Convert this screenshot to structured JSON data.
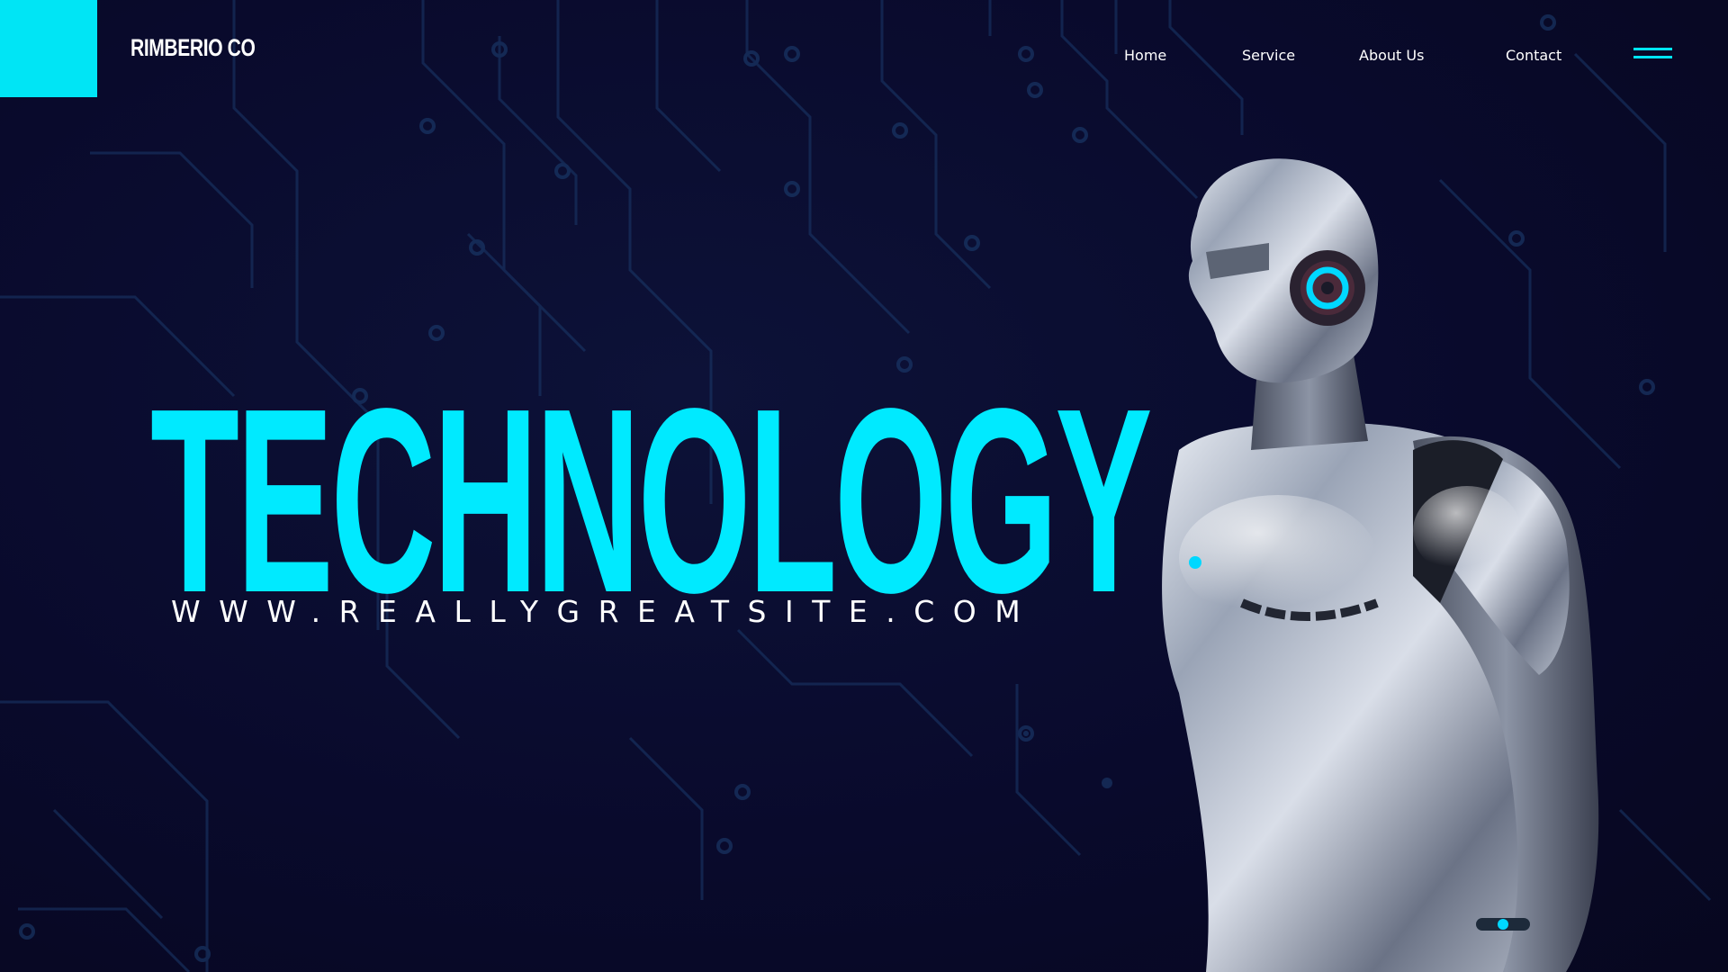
{
  "brand": {
    "name": "RIMBERIO CO",
    "accent_color": "#00e5f5"
  },
  "nav": {
    "items": [
      "Home",
      "Service",
      "About Us",
      "Contact"
    ],
    "menu_icon": "hamburger-menu-icon"
  },
  "hero": {
    "title": "TECHNOLOGY",
    "url": "WWW.REALLYGREATSITE.COM",
    "title_color": "#00eaff",
    "image": "chrome-humanoid-robot-with-headphones"
  },
  "background": {
    "color": "#08082a",
    "pattern": "circuit-board"
  }
}
